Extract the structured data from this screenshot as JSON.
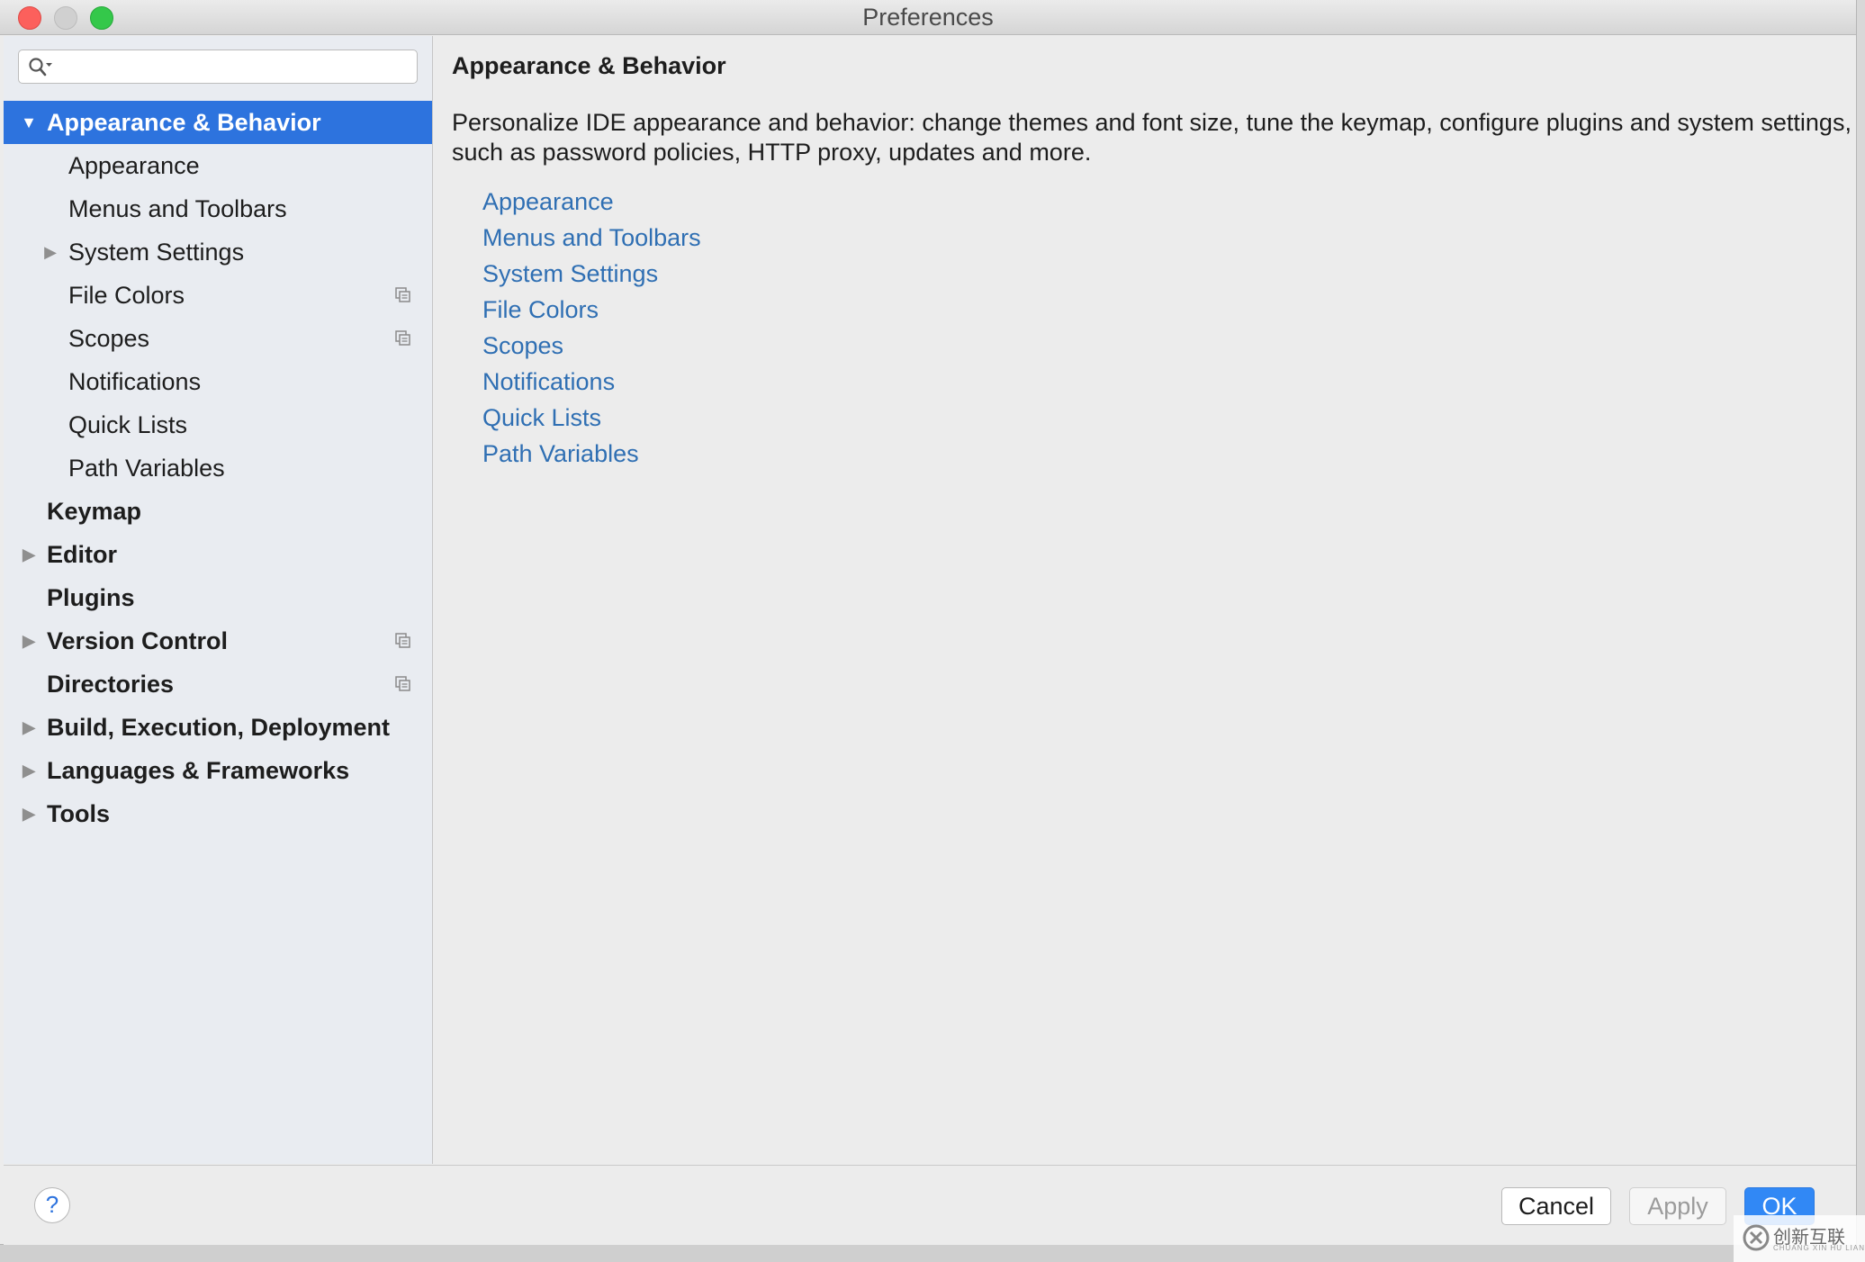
{
  "window": {
    "title": "Preferences"
  },
  "search": {
    "placeholder": "",
    "value": ""
  },
  "tree": [
    {
      "label": "Appearance & Behavior",
      "level": 0,
      "bold": true,
      "arrow": "▼",
      "selected": true
    },
    {
      "label": "Appearance",
      "level": 1
    },
    {
      "label": "Menus and Toolbars",
      "level": 1
    },
    {
      "label": "System Settings",
      "level": 1,
      "arrow": "▶"
    },
    {
      "label": "File Colors",
      "level": 1,
      "badge": "copy-icon"
    },
    {
      "label": "Scopes",
      "level": 1,
      "badge": "copy-icon"
    },
    {
      "label": "Notifications",
      "level": 1
    },
    {
      "label": "Quick Lists",
      "level": 1
    },
    {
      "label": "Path Variables",
      "level": 1
    },
    {
      "label": "Keymap",
      "level": 0,
      "bold": true
    },
    {
      "label": "Editor",
      "level": 0,
      "bold": true,
      "arrow": "▶"
    },
    {
      "label": "Plugins",
      "level": 0,
      "bold": true
    },
    {
      "label": "Version Control",
      "level": 0,
      "bold": true,
      "arrow": "▶",
      "badge": "copy-icon"
    },
    {
      "label": "Directories",
      "level": 0,
      "bold": true,
      "badge": "copy-icon"
    },
    {
      "label": "Build, Execution, Deployment",
      "level": 0,
      "bold": true,
      "arrow": "▶"
    },
    {
      "label": "Languages & Frameworks",
      "level": 0,
      "bold": true,
      "arrow": "▶"
    },
    {
      "label": "Tools",
      "level": 0,
      "bold": true,
      "arrow": "▶"
    }
  ],
  "content": {
    "title": "Appearance & Behavior",
    "description": "Personalize IDE appearance and behavior: change themes and font size, tune the keymap, configure plugins and system settings, such as password policies, HTTP proxy, updates and more.",
    "links": [
      "Appearance",
      "Menus and Toolbars",
      "System Settings",
      "File Colors",
      "Scopes",
      "Notifications",
      "Quick Lists",
      "Path Variables"
    ]
  },
  "footer": {
    "help_label": "?",
    "cancel_label": "Cancel",
    "apply_label": "Apply",
    "ok_label": "OK"
  },
  "watermark": {
    "text": "创新互联",
    "sub": "CHUANG XIN HU LIAN"
  },
  "colors": {
    "selection": "#2d73de",
    "link": "#2f6fb3",
    "ok_button": "#3188f5"
  }
}
